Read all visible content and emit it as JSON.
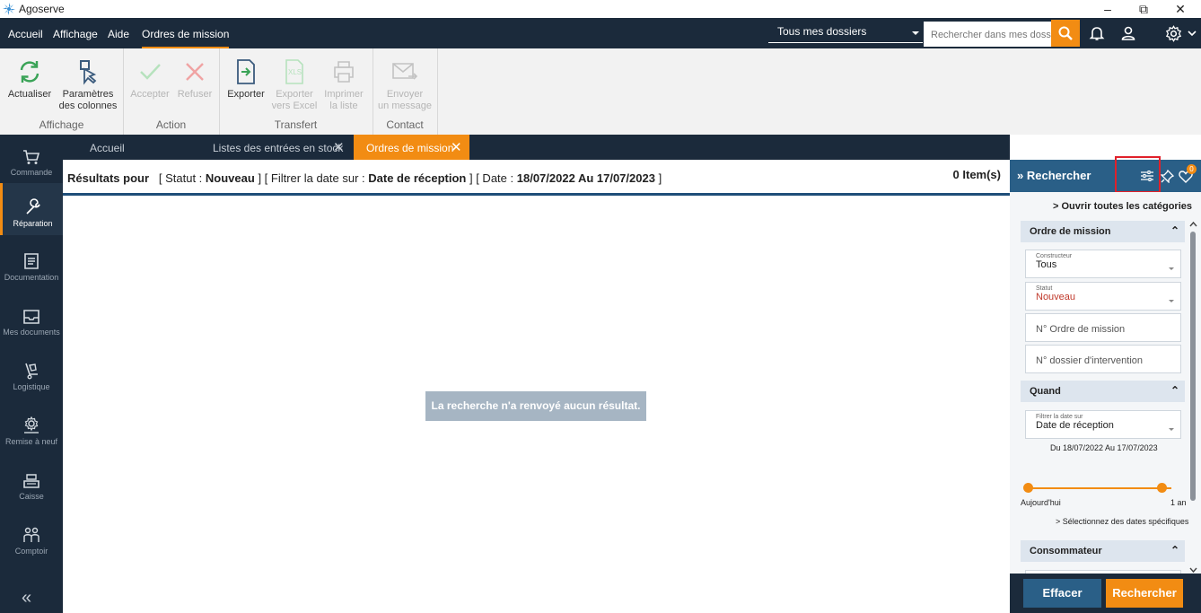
{
  "window": {
    "title": "Agoserve",
    "controls": {
      "minimize": "–",
      "restore": "⧉",
      "close": "✕"
    }
  },
  "menubar": {
    "items": [
      "Accueil",
      "Affichage",
      "Aide",
      "Ordres de mission"
    ],
    "active_item": "Ordres de mission",
    "folder_select": "Tous mes dossiers",
    "search_placeholder": "Rechercher dans mes dossiers",
    "icons": [
      "search-icon",
      "bell-icon",
      "user-icon",
      "gear-icon",
      "chevron-down-icon"
    ]
  },
  "ribbon": {
    "groups": {
      "affichage": "Affichage",
      "action": "Action",
      "transfert": "Transfert",
      "contact": "Contact"
    },
    "buttons": {
      "actualiser": "Actualiser",
      "parametres_1": "Paramètres",
      "parametres_2": "des colonnes",
      "accepter": "Accepter",
      "refuser": "Refuser",
      "exporter": "Exporter",
      "excel_1": "Exporter",
      "excel_2": "vers Excel",
      "imprimer_1": "Imprimer",
      "imprimer_2": "la liste",
      "envoyer_1": "Envoyer",
      "envoyer_2": "un message"
    }
  },
  "leftnav": {
    "items": [
      "Commande",
      "Réparation",
      "Documentation",
      "Mes documents",
      "Logistique",
      "Remise à neuf",
      "Caisse",
      "Comptoir"
    ],
    "active": "Réparation",
    "collapse": "«"
  },
  "tabs": {
    "accueil": "Accueil",
    "stock": "Listes des entrées en stock",
    "ordres": "Ordres de mission",
    "close": "✕"
  },
  "results": {
    "prefix": "Résultats pour",
    "statut_label": "[ Statut :",
    "statut_value": "Nouveau",
    "filtre_label": "]   [ Filtrer la date sur :",
    "filtre_value": "Date de réception",
    "date_label": "]   [ Date :",
    "date_value": "18/07/2022 Au 17/07/2023",
    "suffix": "]",
    "items": "0 Item(s)",
    "empty_message": "La recherche n'a renvoyé aucun résultat."
  },
  "search_panel": {
    "title": "Rechercher",
    "favorites_badge": "0",
    "open_all": "Ouvrir toutes les catégories",
    "categories": {
      "ordre": "Ordre de mission",
      "quand": "Quand",
      "consommateur": "Consommateur"
    },
    "constructeur_label": "Constructeur",
    "constructeur_value": "Tous",
    "statut_label": "Statut",
    "statut_value": "Nouveau",
    "ordre_placeholder": "N° Ordre de mission",
    "dossier_placeholder": "N° dossier d'intervention",
    "filtre_label": "Filtrer la date sur",
    "filtre_value": "Date de réception",
    "date_range": "Du 18/07/2022 Au 17/07/2023",
    "slider_min_label": "Aujourd'hui",
    "slider_max_label": "1 an",
    "select_dates": "> Sélectionnez des dates spécifiques",
    "btn_effacer": "Effacer",
    "btn_rechercher": "Rechercher"
  },
  "colors": {
    "accent": "#f28c13",
    "navy": "#1b2a3b",
    "panel_head": "#2a5f87",
    "highlight_box": "#e0212b"
  }
}
